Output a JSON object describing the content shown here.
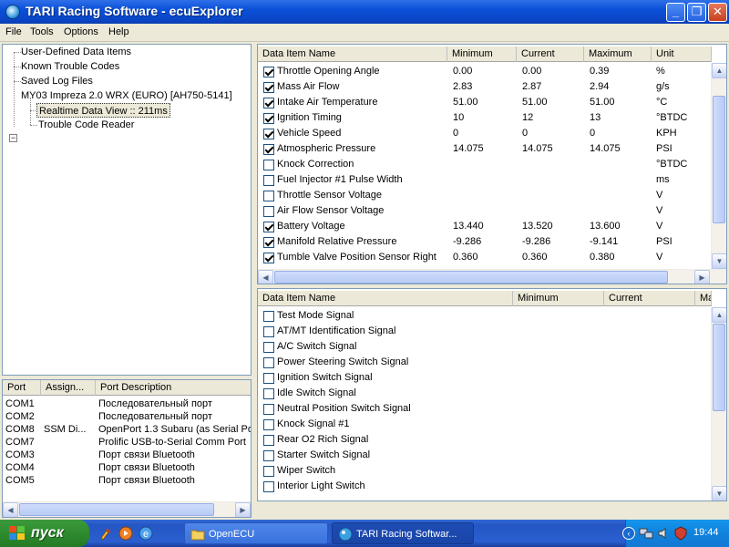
{
  "window": {
    "title": "TARI Racing Software - ecuExplorer"
  },
  "menu": [
    "File",
    "Tools",
    "Options",
    "Help"
  ],
  "tree": {
    "items": [
      "User-Defined Data Items",
      "Known Trouble Codes",
      "Saved Log Files",
      "MY03 Impreza 2.0 WRX (EURO) [AH750-5141]",
      "Realtime Data View :: 211ms",
      "Trouble Code Reader"
    ],
    "expander": "−"
  },
  "ports": {
    "headers": [
      "Port",
      "Assign...",
      "Port Description"
    ],
    "rows": [
      {
        "port": "COM1",
        "assign": "",
        "desc": "Последовательный порт"
      },
      {
        "port": "COM2",
        "assign": "",
        "desc": "Последовательный порт"
      },
      {
        "port": "COM8",
        "assign": "SSM Di...",
        "desc": "OpenPort 1.3 Subaru (as Serial Port)"
      },
      {
        "port": "COM7",
        "assign": "",
        "desc": "Prolific USB-to-Serial Comm Port"
      },
      {
        "port": "COM3",
        "assign": "",
        "desc": "Порт связи Bluetooth"
      },
      {
        "port": "COM4",
        "assign": "",
        "desc": "Порт связи Bluetooth"
      },
      {
        "port": "COM5",
        "assign": "",
        "desc": "Порт связи Bluetooth"
      }
    ]
  },
  "data_grid": {
    "headers": [
      "Data Item Name",
      "Minimum",
      "Current",
      "Maximum",
      "Unit"
    ],
    "rows": [
      {
        "checked": true,
        "name": "Throttle Opening Angle",
        "min": "0.00",
        "cur": "0.00",
        "max": "0.39",
        "unit": "%"
      },
      {
        "checked": true,
        "name": "Mass Air Flow",
        "min": "2.83",
        "cur": "2.87",
        "max": "2.94",
        "unit": "g/s"
      },
      {
        "checked": true,
        "name": "Intake Air Temperature",
        "min": "51.00",
        "cur": "51.00",
        "max": "51.00",
        "unit": "°C"
      },
      {
        "checked": true,
        "name": "Ignition Timing",
        "min": "10",
        "cur": "12",
        "max": "13",
        "unit": "°BTDC"
      },
      {
        "checked": true,
        "name": "Vehicle Speed",
        "min": "0",
        "cur": "0",
        "max": "0",
        "unit": "KPH"
      },
      {
        "checked": true,
        "name": "Atmospheric Pressure",
        "min": "14.075",
        "cur": "14.075",
        "max": "14.075",
        "unit": "PSI"
      },
      {
        "checked": false,
        "name": "Knock Correction",
        "min": "",
        "cur": "",
        "max": "",
        "unit": "°BTDC"
      },
      {
        "checked": false,
        "name": "Fuel Injector #1 Pulse Width",
        "min": "",
        "cur": "",
        "max": "",
        "unit": "ms"
      },
      {
        "checked": false,
        "name": "Throttle Sensor Voltage",
        "min": "",
        "cur": "",
        "max": "",
        "unit": "V"
      },
      {
        "checked": false,
        "name": "Air Flow Sensor Voltage",
        "min": "",
        "cur": "",
        "max": "",
        "unit": "V"
      },
      {
        "checked": true,
        "name": "Battery Voltage",
        "min": "13.440",
        "cur": "13.520",
        "max": "13.600",
        "unit": "V"
      },
      {
        "checked": true,
        "name": "Manifold Relative Pressure",
        "min": "-9.286",
        "cur": "-9.286",
        "max": "-9.141",
        "unit": "PSI"
      },
      {
        "checked": true,
        "name": "Tumble Valve Position Sensor Right",
        "min": "0.360",
        "cur": "0.360",
        "max": "0.380",
        "unit": "V"
      }
    ]
  },
  "switch_grid": {
    "headers": [
      "Data Item Name",
      "Minimum",
      "Current",
      "Ma"
    ],
    "rows": [
      {
        "checked": false,
        "name": "Test Mode Signal"
      },
      {
        "checked": false,
        "name": "AT/MT Identification Signal"
      },
      {
        "checked": false,
        "name": "A/C Switch Signal"
      },
      {
        "checked": false,
        "name": "Power Steering Switch Signal"
      },
      {
        "checked": false,
        "name": "Ignition Switch Signal"
      },
      {
        "checked": false,
        "name": "Idle Switch Signal"
      },
      {
        "checked": false,
        "name": "Neutral Position Switch Signal"
      },
      {
        "checked": false,
        "name": "Knock Signal #1"
      },
      {
        "checked": false,
        "name": "Rear O2 Rich Signal"
      },
      {
        "checked": false,
        "name": "Starter Switch Signal"
      },
      {
        "checked": false,
        "name": "Wiper Switch"
      },
      {
        "checked": false,
        "name": "Interior Light Switch"
      }
    ]
  },
  "taskbar": {
    "start_label": "пуск",
    "tasks": [
      "OpenECU",
      "TARI Racing Softwar..."
    ],
    "clock": "19:44"
  },
  "colors": {
    "title_bar": "#0a50d8",
    "taskbar": "#2456c4",
    "start_button": "#2e8b2e"
  }
}
